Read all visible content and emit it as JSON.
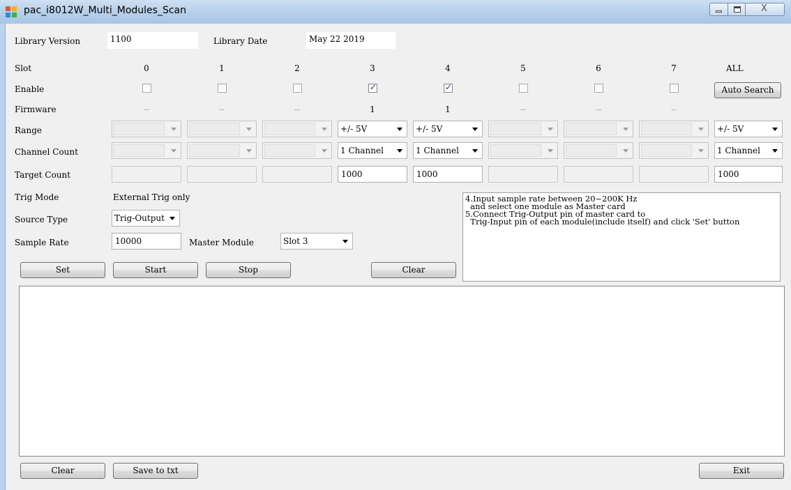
{
  "window": {
    "title": "pac_i8012W_Multi_Modules_Scan",
    "controls": {
      "minimize": "—",
      "maximize": "□",
      "close": "X"
    }
  },
  "library": {
    "version_label": "Library Version",
    "version_value": "1100",
    "date_label": "Library Date",
    "date_value": "May 22 2019"
  },
  "rows": {
    "slot_label": "Slot",
    "enable_label": "Enable",
    "firmware_label": "Firmware",
    "range_label": "Range",
    "channel_count_label": "Channel Count",
    "target_count_label": "Target Count"
  },
  "slots": [
    {
      "slot": "0",
      "enabled": false,
      "firmware": "--",
      "range": "",
      "channel_count": "",
      "target_count": ""
    },
    {
      "slot": "1",
      "enabled": false,
      "firmware": "--",
      "range": "",
      "channel_count": "",
      "target_count": ""
    },
    {
      "slot": "2",
      "enabled": false,
      "firmware": "--",
      "range": "",
      "channel_count": "",
      "target_count": ""
    },
    {
      "slot": "3",
      "enabled": true,
      "firmware": "1",
      "range": "+/- 5V",
      "channel_count": "1 Channel",
      "target_count": "1000"
    },
    {
      "slot": "4",
      "enabled": true,
      "firmware": "1",
      "range": "+/- 5V",
      "channel_count": "1 Channel",
      "target_count": "1000"
    },
    {
      "slot": "5",
      "enabled": false,
      "firmware": "--",
      "range": "",
      "channel_count": "",
      "target_count": ""
    },
    {
      "slot": "6",
      "enabled": false,
      "firmware": "--",
      "range": "",
      "channel_count": "",
      "target_count": ""
    },
    {
      "slot": "7",
      "enabled": false,
      "firmware": "--",
      "range": "",
      "channel_count": "",
      "target_count": ""
    }
  ],
  "all_column": {
    "header": "ALL",
    "auto_search_label": "Auto Search",
    "range": "+/- 5V",
    "channel_count": "1 Channel",
    "target_count": "1000"
  },
  "settings": {
    "trig_mode_label": "Trig Mode",
    "trig_mode_value": "External Trig only",
    "source_type_label": "Source Type",
    "source_type_value": "Trig-Output",
    "sample_rate_label": "Sample Rate",
    "sample_rate_value": "10000",
    "master_module_label": "Master Module",
    "master_module_value": "Slot 3"
  },
  "instructions": "4.Input sample rate between 20~200K Hz\n  and select one module as Master card\n5.Connect Trig-Output pin of master card to\n  Trig-Input pin of each module(include itself) and click 'Set' button",
  "buttons": {
    "set": "Set",
    "start": "Start",
    "stop": "Stop",
    "clear_top": "Clear",
    "clear_bottom": "Clear",
    "save_to_txt": "Save to txt",
    "exit": "Exit"
  },
  "colors": {
    "titlebar": "#b9d1ea",
    "client_bg": "#f0f0f0",
    "check_tick": "#2c4c8a"
  }
}
